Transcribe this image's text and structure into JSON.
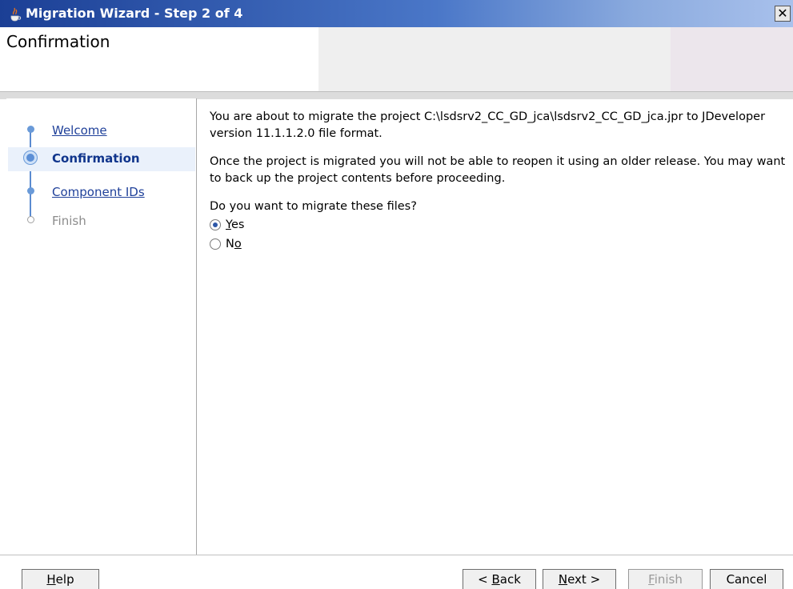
{
  "window": {
    "title": "Migration Wizard - Step 2 of 4",
    "close_glyph": "✕"
  },
  "header": {
    "title": "Confirmation"
  },
  "nav": {
    "items": [
      {
        "label": "Welcome",
        "state": "link"
      },
      {
        "label": "Confirmation",
        "state": "current"
      },
      {
        "label": "Component IDs",
        "state": "link"
      },
      {
        "label": "Finish",
        "state": "disabled"
      }
    ]
  },
  "content": {
    "intro": "You are about to migrate the project C:\\lsdsrv2_CC_GD_jca\\lsdsrv2_CC_GD_jca.jpr to JDeveloper version 11.1.1.2.0 file format.",
    "warning": "Once the project is migrated you will not be able to reopen it using an older release. You may want to back up the project contents before proceeding.",
    "question": "Do you want to migrate these files?",
    "options": [
      {
        "mnemonic": "Y",
        "rest": "es",
        "selected": true
      },
      {
        "prefix": "N",
        "mnemonic": "o",
        "selected": false
      }
    ]
  },
  "buttons": {
    "help": {
      "mnemonic": "H",
      "rest": "elp"
    },
    "back": {
      "prefix": "< ",
      "mnemonic": "B",
      "rest": "ack"
    },
    "next": {
      "mnemonic": "N",
      "rest": "ext >"
    },
    "finish": {
      "mnemonic": "F",
      "rest": "inish",
      "enabled": false
    },
    "cancel": {
      "label": "Cancel"
    }
  },
  "colors": {
    "titlebar": "#1b3f95",
    "link": "#20419a",
    "accent": "#5b8bd0"
  }
}
